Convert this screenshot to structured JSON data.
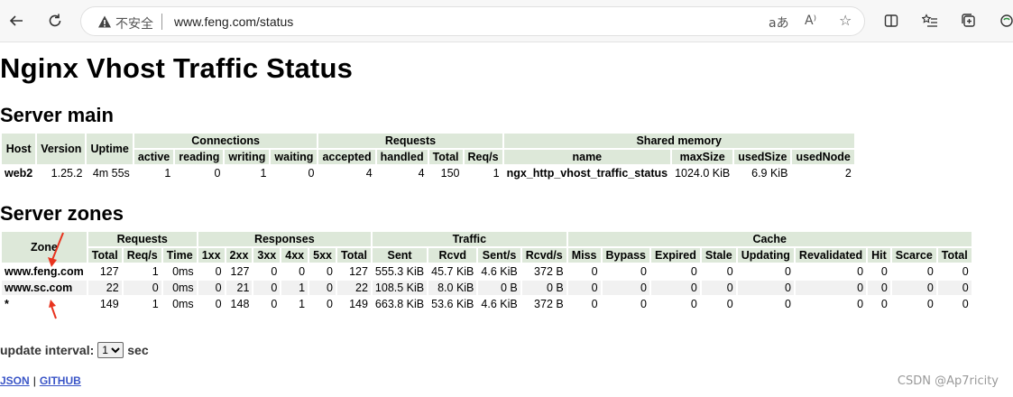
{
  "browser": {
    "insecure_label": "不安全",
    "url": "www.feng.com/status"
  },
  "page": {
    "title": "Nginx Vhost Traffic Status",
    "server_main_heading": "Server main",
    "server_zones_heading": "Server zones"
  },
  "server_main": {
    "group_headers": {
      "connections": "Connections",
      "requests": "Requests",
      "shared_memory": "Shared memory"
    },
    "headers": {
      "host": "Host",
      "version": "Version",
      "uptime": "Uptime",
      "active": "active",
      "reading": "reading",
      "writing": "writing",
      "waiting": "waiting",
      "accepted": "accepted",
      "handled": "handled",
      "total": "Total",
      "req_s": "Req/s",
      "name": "name",
      "max_size": "maxSize",
      "used_size": "usedSize",
      "used_node": "usedNode"
    },
    "row": {
      "host": "web2",
      "version": "1.25.2",
      "uptime": "4m 55s",
      "active": "1",
      "reading": "0",
      "writing": "1",
      "waiting": "0",
      "accepted": "4",
      "handled": "4",
      "total": "150",
      "req_s": "1",
      "name": "ngx_http_vhost_traffic_status",
      "max_size": "1024.0 KiB",
      "used_size": "6.9 KiB",
      "used_node": "2"
    }
  },
  "server_zones": {
    "group_headers": {
      "zone": "Zone",
      "requests": "Requests",
      "responses": "Responses",
      "traffic": "Traffic",
      "cache": "Cache"
    },
    "headers": {
      "req_total": "Total",
      "req_s": "Req/s",
      "time": "Time",
      "r1xx": "1xx",
      "r2xx": "2xx",
      "r3xx": "3xx",
      "r4xx": "4xx",
      "r5xx": "5xx",
      "resp_total": "Total",
      "sent": "Sent",
      "rcvd": "Rcvd",
      "sent_s": "Sent/s",
      "rcvd_s": "Rcvd/s",
      "miss": "Miss",
      "bypass": "Bypass",
      "expired": "Expired",
      "stale": "Stale",
      "updating": "Updating",
      "revalidated": "Revalidated",
      "hit": "Hit",
      "scarce": "Scarce",
      "cache_total": "Total"
    },
    "rows": [
      {
        "zone": "www.feng.com",
        "req_total": "127",
        "req_s": "1",
        "time": "0ms",
        "r1xx": "0",
        "r2xx": "127",
        "r3xx": "0",
        "r4xx": "0",
        "r5xx": "0",
        "resp_total": "127",
        "sent": "555.3 KiB",
        "rcvd": "45.7 KiB",
        "sent_s": "4.6 KiB",
        "rcvd_s": "372 B",
        "miss": "0",
        "bypass": "0",
        "expired": "0",
        "stale": "0",
        "updating": "0",
        "revalidated": "0",
        "hit": "0",
        "scarce": "0",
        "cache_total": "0"
      },
      {
        "zone": "www.sc.com",
        "req_total": "22",
        "req_s": "0",
        "time": "0ms",
        "r1xx": "0",
        "r2xx": "21",
        "r3xx": "0",
        "r4xx": "1",
        "r5xx": "0",
        "resp_total": "22",
        "sent": "108.5 KiB",
        "rcvd": "8.0 KiB",
        "sent_s": "0 B",
        "rcvd_s": "0 B",
        "miss": "0",
        "bypass": "0",
        "expired": "0",
        "stale": "0",
        "updating": "0",
        "revalidated": "0",
        "hit": "0",
        "scarce": "0",
        "cache_total": "0"
      },
      {
        "zone": "*",
        "req_total": "149",
        "req_s": "1",
        "time": "0ms",
        "r1xx": "0",
        "r2xx": "148",
        "r3xx": "0",
        "r4xx": "1",
        "r5xx": "0",
        "resp_total": "149",
        "sent": "663.8 KiB",
        "rcvd": "53.6 KiB",
        "sent_s": "4.6 KiB",
        "rcvd_s": "372 B",
        "miss": "0",
        "bypass": "0",
        "expired": "0",
        "stale": "0",
        "updating": "0",
        "revalidated": "0",
        "hit": "0",
        "scarce": "0",
        "cache_total": "0"
      }
    ]
  },
  "update": {
    "label": "update interval:",
    "value": "1",
    "unit": "sec"
  },
  "links": {
    "json": "JSON",
    "github": "GITHUB"
  },
  "watermark": "CSDN @Ap7ricity",
  "colors": {
    "header_bg": "#dde8d9",
    "row_alt_bg": "#f1f1f1",
    "link": "#3a55c7",
    "arrow": "#e8331e"
  }
}
